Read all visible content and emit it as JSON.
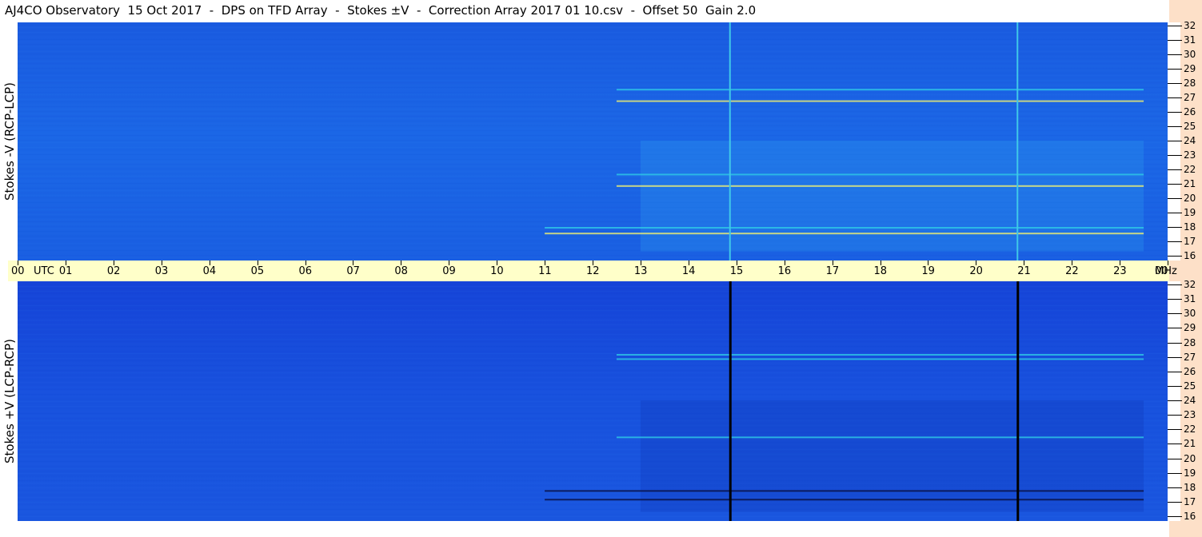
{
  "title": "AJ4CO Observatory  15 Oct 2017  -  DPS on TFD Array  -  Stokes ±V  -  Correction Array 2017 01 10.csv  -  Offset 50  Gain 2.0",
  "panels": {
    "top_label": "Stokes -V (RCP-LCP)",
    "bottom_label": "Stokes +V (LCP-RCP)"
  },
  "time_axis": {
    "labels": [
      "00",
      "UTC",
      "01",
      "02",
      "03",
      "04",
      "05",
      "06",
      "07",
      "08",
      "09",
      "10",
      "11",
      "12",
      "13",
      "14",
      "15",
      "16",
      "17",
      "18",
      "19",
      "20",
      "21",
      "22",
      "23",
      "00",
      "MHz"
    ]
  },
  "freq_axis": {
    "labels": [
      "32",
      "31",
      "30",
      "29",
      "28",
      "27",
      "26",
      "25",
      "24",
      "23",
      "22",
      "21",
      "20",
      "19",
      "18",
      "17",
      "16"
    ]
  },
  "colors": {
    "background_blue": "#1b63e4",
    "axis_band": "#ffffc9",
    "right_strip": "#fde0c8",
    "emission_cyan": "#2ec9e6",
    "emission_yellow": "#f0f070"
  },
  "chart_data": {
    "type": "heatmap",
    "title": "AJ4CO Observatory  15 Oct 2017  -  DPS on TFD Array  -  Stokes ±V  -  Correction Array 2017 01 10.csv  -  Offset 50  Gain 2.0",
    "x_unit": "UTC",
    "y_unit": "MHz",
    "xlim": [
      0,
      24
    ],
    "ylim": [
      16,
      32
    ],
    "panels": [
      {
        "name": "Stokes -V (RCP-LCP)",
        "vertical_lines_utc": [
          14.85,
          20.85
        ],
        "emission_bands_mhz": [
          17.6,
          18.0,
          20.9,
          21.7,
          26.8,
          27.6
        ],
        "activity_window_utc": [
          11,
          23.5
        ]
      },
      {
        "name": "Stokes +V (LCP-RCP)",
        "vertical_lines_utc": [
          14.85,
          20.85
        ],
        "emission_bands_mhz": [
          17.2,
          17.8,
          21.5,
          26.9,
          27.2
        ],
        "activity_window_utc": [
          11,
          23.5
        ]
      }
    ]
  }
}
